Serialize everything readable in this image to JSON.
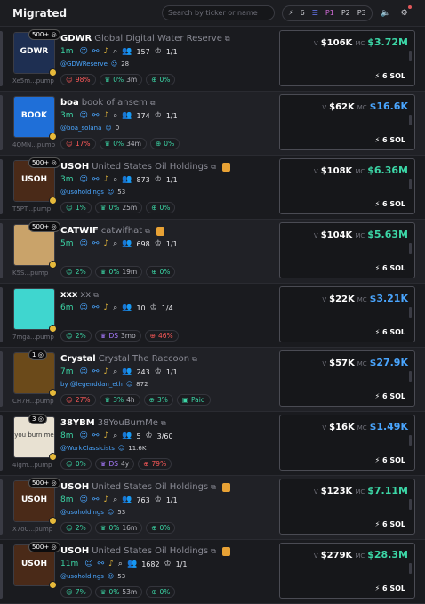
{
  "header": {
    "title": "Migrated",
    "search_placeholder": "Search by ticker or name",
    "quick_buy": "6",
    "presets": [
      "P1",
      "P2",
      "P3"
    ]
  },
  "icons": {
    "flash": "lightning-icon",
    "list": "list-icon",
    "sound": "speaker-icon",
    "settings": "sliders-icon"
  },
  "tokens": [
    {
      "badge": "500+",
      "addr": "Xe5m...pump",
      "thumb_color": "#1e2f52",
      "thumb_text": "GDWR",
      "symbol": "GDWR",
      "name": "Global Digital Water Reserve",
      "has_note": false,
      "age": "1m",
      "holders": "157",
      "holders_icon": "users-icon",
      "pro": "1/1",
      "social_handle": "@GDWReserve",
      "social_count": "28",
      "pills": [
        {
          "cls": "red",
          "icon": "user-icon",
          "text": "98%"
        },
        {
          "cls": "grn",
          "icon": "chef-icon",
          "text": "0%",
          "extra": "3m"
        },
        {
          "cls": "grn",
          "icon": "target-icon",
          "text": "0%"
        }
      ],
      "v": "$106K",
      "mc": "$3.72M",
      "mc_color": "g",
      "sol": "6 SOL"
    },
    {
      "badge": "",
      "addr": "4QMN...pump",
      "thumb_color": "#1f6fd8",
      "thumb_text": "BOOK",
      "symbol": "boa",
      "name": "book of ansem",
      "has_note": false,
      "age": "3m",
      "holders": "174",
      "holders_icon": "users-icon",
      "pro": "1/1",
      "social_handle": "@boa_solana",
      "social_count": "0",
      "pills": [
        {
          "cls": "red",
          "icon": "user-icon",
          "text": "17%"
        },
        {
          "cls": "grn",
          "icon": "chef-icon",
          "text": "0%",
          "extra": "34m"
        },
        {
          "cls": "grn",
          "icon": "target-icon",
          "text": "0%"
        }
      ],
      "v": "$62K",
      "mc": "$16.6K",
      "mc_color": "b",
      "sol": "6 SOL"
    },
    {
      "badge": "500+",
      "addr": "T5PT...pump",
      "thumb_color": "#4a2a18",
      "thumb_text": "USOH",
      "symbol": "USOH",
      "name": "United States Oil Holdings",
      "has_note": true,
      "age": "3m",
      "holders": "873",
      "holders_icon": "users-icon",
      "pro": "1/1",
      "social_handle": "@usoholdings",
      "social_count": "53",
      "pills": [
        {
          "cls": "grn",
          "icon": "user-icon",
          "text": "1%"
        },
        {
          "cls": "grn",
          "icon": "chef-icon",
          "text": "0%",
          "extra": "25m"
        },
        {
          "cls": "grn",
          "icon": "target-icon",
          "text": "0%"
        }
      ],
      "v": "$108K",
      "mc": "$6.36M",
      "mc_color": "g",
      "sol": "6 SOL"
    },
    {
      "badge": "500+",
      "addr": "K5S...pump",
      "thumb_color": "#c9a36a",
      "thumb_text": "",
      "symbol": "CATWIF",
      "name": "catwifhat",
      "has_note": true,
      "age": "5m",
      "holders": "698",
      "holders_icon": "users-icon",
      "pro": "1/1",
      "social_handle": "",
      "social_count": "",
      "pills": [
        {
          "cls": "grn",
          "icon": "user-icon",
          "text": "2%"
        },
        {
          "cls": "grn",
          "icon": "chef-icon",
          "text": "0%",
          "extra": "19m"
        },
        {
          "cls": "grn",
          "icon": "target-icon",
          "text": "0%"
        }
      ],
      "v": "$104K",
      "mc": "$5.63M",
      "mc_color": "g",
      "sol": "6 SOL"
    },
    {
      "badge": "",
      "addr": "7mga...pump",
      "thumb_color": "#3fd6cf",
      "thumb_text": "",
      "symbol": "xxx",
      "name": "xx",
      "has_note": false,
      "age": "6m",
      "holders": "10",
      "holders_icon": "users-icon",
      "pro": "1/4",
      "social_handle": "",
      "social_count": "",
      "pills": [
        {
          "cls": "grn",
          "icon": "user-icon",
          "text": "2%"
        },
        {
          "cls": "pur",
          "icon": "chef-icon",
          "text": "DS",
          "extra": "3mo"
        },
        {
          "cls": "red",
          "icon": "target-icon",
          "text": "46%"
        }
      ],
      "v": "$22K",
      "mc": "$3.21K",
      "mc_color": "b",
      "sol": "6 SOL"
    },
    {
      "badge": "1",
      "addr": "CH7H...pump",
      "thumb_color": "#6b4a1a",
      "thumb_text": "",
      "symbol": "Crystal",
      "name": "Crystal The Raccoon",
      "has_note": false,
      "age": "7m",
      "holders": "243",
      "holders_icon": "users-icon",
      "pro": "1/1",
      "social_handle": "by @legenddan_eth",
      "social_count": "872",
      "pills": [
        {
          "cls": "red",
          "icon": "user-icon",
          "text": "27%"
        },
        {
          "cls": "grn",
          "icon": "chef-icon",
          "text": "3%",
          "extra": "4h"
        },
        {
          "cls": "grn",
          "icon": "target-icon",
          "text": "3%"
        },
        {
          "cls": "grn",
          "icon": "paid-icon",
          "text": "Paid"
        }
      ],
      "v": "$57K",
      "mc": "$27.9K",
      "mc_color": "b",
      "sol": "6 SOL"
    },
    {
      "badge": "3",
      "addr": "4igm...pump",
      "thumb_color": "#e8e1d2",
      "thumb_text": "you burn me",
      "symbol": "38YBM",
      "name": "38YouBurnMe",
      "has_note": false,
      "age": "8m",
      "holders": "5",
      "holders_icon": "users-icon",
      "pro": "3/60",
      "social_handle": "@WorkClassicists",
      "social_count": "11.6K",
      "pills": [
        {
          "cls": "grn",
          "icon": "user-icon",
          "text": "0%"
        },
        {
          "cls": "pur",
          "icon": "chef-icon",
          "text": "DS",
          "extra": "4y"
        },
        {
          "cls": "red",
          "icon": "target-icon",
          "text": "79%"
        }
      ],
      "v": "$16K",
      "mc": "$1.49K",
      "mc_color": "b",
      "sol": "6 SOL"
    },
    {
      "badge": "500+",
      "addr": "X7oC...pump",
      "thumb_color": "#4a2a18",
      "thumb_text": "USOH",
      "symbol": "USOH",
      "name": "United States Oil Holdings",
      "has_note": true,
      "age": "8m",
      "holders": "763",
      "holders_icon": "users-icon",
      "pro": "1/1",
      "social_handle": "@usoholdings",
      "social_count": "53",
      "pills": [
        {
          "cls": "grn",
          "icon": "user-icon",
          "text": "2%"
        },
        {
          "cls": "grn",
          "icon": "chef-icon",
          "text": "0%",
          "extra": "16m"
        },
        {
          "cls": "grn",
          "icon": "target-icon",
          "text": "0%"
        }
      ],
      "v": "$123K",
      "mc": "$7.11M",
      "mc_color": "g",
      "sol": "6 SOL"
    },
    {
      "badge": "500+",
      "addr": "",
      "thumb_color": "#4a2a18",
      "thumb_text": "USOH",
      "symbol": "USOH",
      "name": "United States Oil Holdings",
      "has_note": true,
      "age": "11m",
      "holders": "1682",
      "holders_icon": "users-icon",
      "pro": "1/1",
      "social_handle": "@usoholdings",
      "social_count": "53",
      "pills": [
        {
          "cls": "grn",
          "icon": "user-icon",
          "text": "7%"
        },
        {
          "cls": "grn",
          "icon": "chef-icon",
          "text": "0%",
          "extra": "53m"
        },
        {
          "cls": "grn",
          "icon": "target-icon",
          "text": "0%"
        }
      ],
      "v": "$279K",
      "mc": "$28.3M",
      "mc_color": "g",
      "sol": "6 SOL"
    }
  ],
  "labels": {
    "v": "V",
    "mc": "MC"
  }
}
